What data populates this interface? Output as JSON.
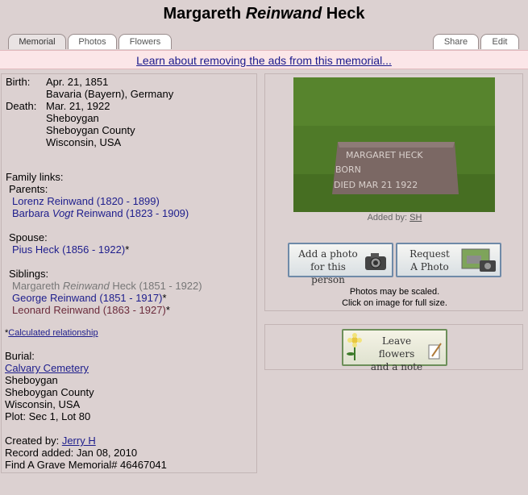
{
  "title": {
    "first": "Margareth",
    "middle": "Reinwand",
    "last": "Heck"
  },
  "tabs": {
    "memorial": "Memorial",
    "photos": "Photos",
    "flowers": "Flowers",
    "share": "Share",
    "edit": "Edit"
  },
  "ad_link": "Learn about removing the ads from this memorial...",
  "birth": {
    "label": "Birth:",
    "date": "Apr. 21, 1851",
    "place": "Bavaria (Bayern), Germany"
  },
  "death": {
    "label": "Death:",
    "date": "Mar. 21, 1922",
    "place1": "Sheboygan",
    "place2": "Sheboygan County",
    "place3": "Wisconsin, USA"
  },
  "family": {
    "heading": "Family links:",
    "parents_label": "Parents:",
    "parents": [
      {
        "text": "Lorenz Reinwand (1820 - 1899)"
      },
      {
        "pre": "Barbara ",
        "italic": "Vogt",
        "post": " Reinwand (1823 - 1909)"
      }
    ],
    "spouse_label": "Spouse:",
    "spouse": "Pius Heck (1856 - 1922)",
    "spouse_mark": "*",
    "siblings_label": "Siblings:",
    "siblings": [
      {
        "pre": "Margareth ",
        "italic": "Reinwand",
        "post": " Heck (1851 - 1922)"
      },
      {
        "text": "George Reinwand (1851 - 1917)",
        "mark": "*"
      },
      {
        "text": "Leonard Reinwand (1863 - 1927)",
        "mark": "*"
      }
    ],
    "calc_star": "*",
    "calc_link": "Calculated relationship"
  },
  "burial": {
    "label": "Burial:",
    "cemetery": "Calvary Cemetery",
    "line1": "Sheboygan",
    "line2": "Sheboygan County",
    "line3": "Wisconsin, USA",
    "plot": "Plot: Sec 1, Lot 80"
  },
  "created": {
    "label": "Created by: ",
    "user": "Jerry H",
    "record": "Record added: Jan 08, 2010",
    "memorial": "Find A Grave Memorial# 46467041"
  },
  "photo": {
    "added_label": "Added by: ",
    "added_user": "SH",
    "stone_line1": "MARGARET HECK",
    "stone_line2": "BORN",
    "stone_line3": "DIED MAR 21 1922"
  },
  "buttons": {
    "add_photo_1": "Add a photo",
    "add_photo_2": "for this person",
    "request_1": "Request",
    "request_2": "A Photo",
    "flowers_1": "Leave flowers",
    "flowers_2": "and a note"
  },
  "photo_note": {
    "line1": "Photos may be scaled.",
    "line2": "Click on image for full size."
  }
}
